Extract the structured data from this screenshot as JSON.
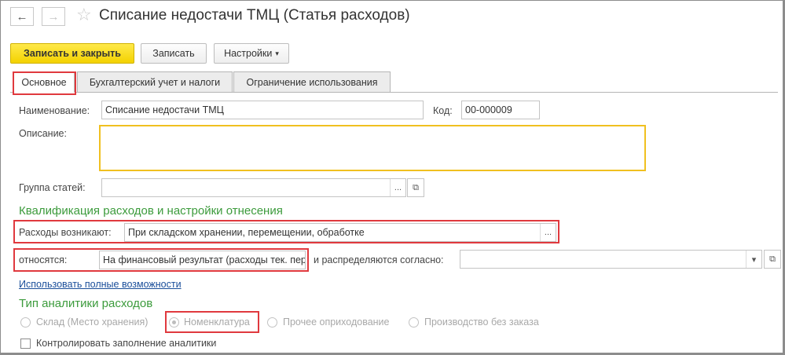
{
  "header": {
    "back_icon": "arrow-left-icon",
    "forward_icon": "arrow-right-icon",
    "favorite_icon": "star-icon",
    "title": "Списание недостачи ТМЦ (Статья расходов)"
  },
  "toolbar": {
    "save_close_label": "Записать и закрыть",
    "save_label": "Записать",
    "settings_label": "Настройки"
  },
  "tabs": [
    {
      "label": "Основное",
      "active": true
    },
    {
      "label": "Бухгалтерский учет и налоги",
      "active": false
    },
    {
      "label": "Ограничение использования",
      "active": false
    }
  ],
  "form": {
    "name_label": "Наименование:",
    "name_value": "Списание недостачи ТМЦ",
    "code_label": "Код:",
    "code_value": "00-000009",
    "description_label": "Описание:",
    "description_value": "",
    "group_label": "Группа статей:",
    "group_value": "",
    "select_button": "...",
    "open_button": "⧉"
  },
  "qualification": {
    "section_title": "Квалификация расходов и настройки отнесения",
    "arise_label": "Расходы возникают:",
    "arise_value": "При складском хранении, перемещении, обработке",
    "relate_label": "относятся:",
    "relate_value": "На финансовый результат (расходы тек. пери",
    "distribute_label": "и распределяются согласно:",
    "distribute_value": "",
    "dropdown_icon": "▾",
    "full_features_link": "Использовать полные возможности"
  },
  "analytics": {
    "section_title": "Тип аналитики расходов",
    "options": [
      {
        "label": "Склад (Место хранения)",
        "checked": false
      },
      {
        "label": "Номенклатура",
        "checked": true
      },
      {
        "label": "Прочее оприходование",
        "checked": false
      },
      {
        "label": "Производство без заказа",
        "checked": false
      }
    ],
    "control_label": "Контролировать заполнение аналитики",
    "control_checked": false
  },
  "colors": {
    "accent_green": "#3c9b3c",
    "highlight_red": "#e0393e",
    "primary_yellow": "#f3d200",
    "link_blue": "#1a4e9a"
  }
}
